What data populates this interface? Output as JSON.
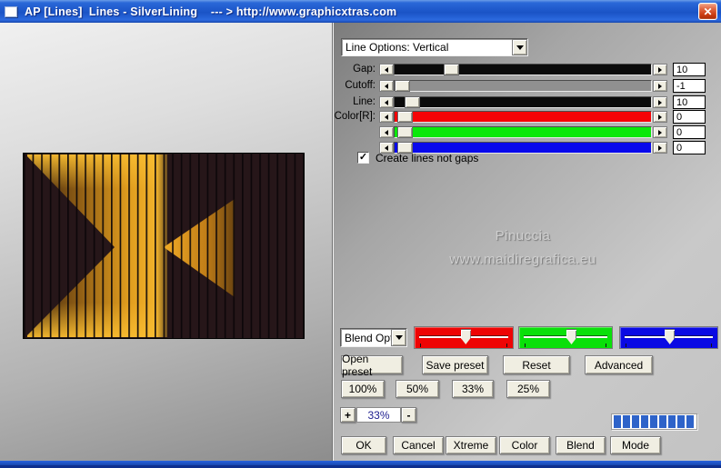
{
  "titlebar": {
    "title": "AP [Lines]  Lines - SilverLining    --- > http://www.graphicxtras.com",
    "close_glyph": "✕"
  },
  "line_options": {
    "value": "Line Options: Vertical"
  },
  "sliders": [
    {
      "label": "Gap:",
      "value": "10",
      "track_color": "#0b0b0b",
      "thumb_pct": 19
    },
    {
      "label": "Cutoff:",
      "value": "-1",
      "track_color": "#909090",
      "thumb_pct": 0
    },
    {
      "label": "Line:",
      "value": "10",
      "track_color": "#0b0b0b",
      "thumb_pct": 4
    },
    {
      "label": "Color[R]:",
      "value": "0",
      "track_color": "#f50306",
      "thumb_pct": 1
    },
    {
      "label": "",
      "value": "0",
      "track_color": "#0ae80a",
      "thumb_pct": 1
    },
    {
      "label": "",
      "value": "0",
      "track_color": "#0808ec",
      "thumb_pct": 1
    }
  ],
  "checkbox": {
    "label": "Create lines not gaps",
    "checked": true,
    "check_glyph": "✓"
  },
  "watermark": {
    "line1": "Pinuccia",
    "line2": "www.maidiregrafica.eu"
  },
  "blend": {
    "dropdown_value": "Blend Opti",
    "sliders": [
      {
        "name": "red-blend-slider",
        "color": "#ee0404",
        "pointer_pct": 47
      },
      {
        "name": "green-blend-slider",
        "color": "#0ae00a",
        "pointer_pct": 51
      },
      {
        "name": "blue-blend-slider",
        "color": "#0a0ae4",
        "pointer_pct": 46
      }
    ]
  },
  "preset_buttons": [
    "Open preset",
    "Save preset",
    "Reset",
    "Advanced"
  ],
  "percent_buttons": [
    "100%",
    "50%",
    "33%",
    "25%"
  ],
  "zoom_control": {
    "plus": "+",
    "value": "33%",
    "minus": "-"
  },
  "progress": {
    "segments": 9,
    "color": "#2e63c9"
  },
  "action_buttons": [
    "OK",
    "Cancel",
    "Xtreme",
    "Color",
    "Blend",
    "Mode"
  ],
  "preview": {
    "description": "gold triangles on dark striped background",
    "colors": {
      "background": "#261619",
      "gold_bright": "#f7bb30",
      "gold_mid": "#c8871b",
      "line": "#0b0609"
    }
  }
}
